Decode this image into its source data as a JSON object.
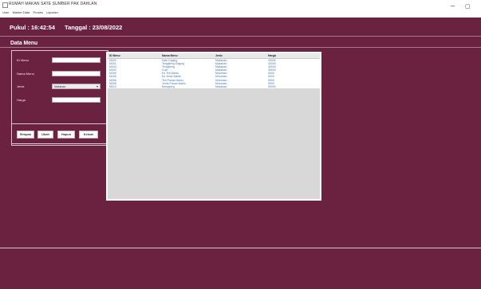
{
  "window": {
    "title": "RUMAH MAKAN SATE SUMBER PAK DAHLAN",
    "menus": [
      "User",
      "Master Data",
      "Proses",
      "Laporan"
    ],
    "minimize_glyph": "–",
    "maximize_glyph": "▢"
  },
  "clock": {
    "time_label": "Pukul",
    "time": "16:42:54",
    "date_label": "Tanggal",
    "date": "23/08/2022",
    "separator": ":"
  },
  "section_title": "Data Menu",
  "form": {
    "id_label": "ID Menu",
    "id_value": "",
    "name_label": "Nama Menu",
    "name_value": "",
    "type_label": "Jenis",
    "type_value": "Makanan",
    "price_label": "Harga",
    "price_value": ""
  },
  "buttons": {
    "save": "Simpan",
    "edit": "Ubah",
    "delete": "Hapus",
    "exit": "Keluar"
  },
  "table": {
    "headers": [
      "ID Menu",
      "Nama Menu",
      "Jenis",
      "Harga"
    ],
    "rows": [
      [
        "M002",
        "Sate Daging",
        "Makanan",
        "40000"
      ],
      [
        "M001",
        "Tengkleng Daging",
        "Makanan",
        "40000"
      ],
      [
        "M003",
        "Tengkleng",
        "Makanan",
        "30000"
      ],
      [
        "M004",
        "Gule",
        "Makanan",
        "35000"
      ],
      [
        "M009",
        "Es Teh Manis",
        "Minuman",
        "5000"
      ],
      [
        "M005",
        "Es Jeruk Manis",
        "Minuman",
        "5000"
      ],
      [
        "M006",
        "Teh Panas Manis",
        "Minuman",
        "5000"
      ],
      [
        "M008",
        "Jeruk Panas Manis",
        "Minuman",
        "5000"
      ],
      [
        "M010",
        "Mangberg",
        "Makanan",
        "50000"
      ]
    ]
  }
}
